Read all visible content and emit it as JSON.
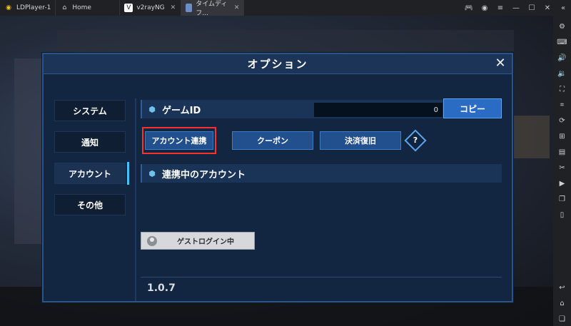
{
  "window": {
    "tabs": [
      {
        "label": "LDPlayer-1",
        "icon": "ldplayer-logo-icon"
      },
      {
        "label": "Home",
        "icon": "home-icon"
      },
      {
        "label": "v2rayNG",
        "icon": "v2ray-icon"
      },
      {
        "label": "タイムディフ...",
        "icon": "game-icon"
      }
    ]
  },
  "dialog": {
    "title": "オプション",
    "nav": [
      {
        "label": "システム"
      },
      {
        "label": "通知"
      },
      {
        "label": "アカウント"
      },
      {
        "label": "その他"
      }
    ],
    "game_id": {
      "label": "ゲームID",
      "value": "0",
      "copy_label": "コピー"
    },
    "buttons": {
      "account_link": "アカウント連携",
      "coupon": "クーポン",
      "payment_restore": "決済復旧",
      "help": "?"
    },
    "linked_accounts": {
      "label": "連携中のアカウント",
      "guest_login": "ゲストログイン中"
    },
    "version": "1.0.7"
  },
  "colors": {
    "accent": "#43c1ff",
    "highlight": "#ff3030",
    "button": "#224f8d"
  }
}
